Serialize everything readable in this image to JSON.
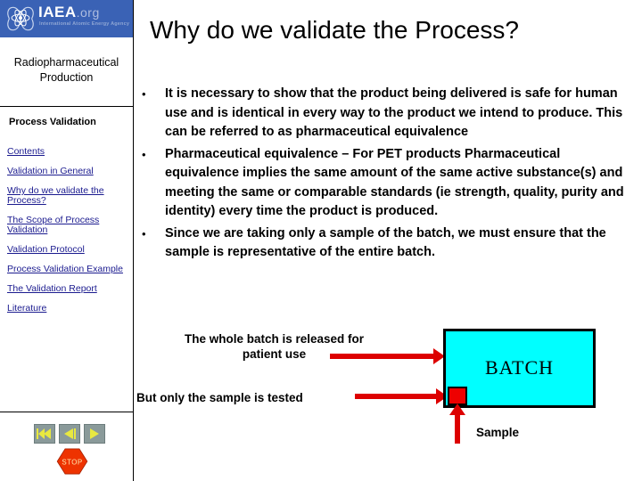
{
  "sidebar": {
    "logo": {
      "wordmark": "IAEA",
      "domain": ".org",
      "subtitle": "International Atomic Energy Agency",
      "banner_color": "#3a62b5"
    },
    "course_title": "Radiopharmaceutical Production",
    "section_label": "Process Validation",
    "links": [
      {
        "label": "Contents"
      },
      {
        "label": "Validation in General"
      },
      {
        "label": "Why do we validate the Process?"
      },
      {
        "label": "The Scope of Process Validation"
      },
      {
        "label": "Validation Protocol"
      },
      {
        "label": "Process Validation Example"
      },
      {
        "label": "The Validation Report"
      },
      {
        "label": "Literature"
      }
    ],
    "link_color": "#1b1b8f",
    "nav_buttons": [
      {
        "name": "first-slide-button",
        "glyph": "⏮"
      },
      {
        "name": "previous-slide-button",
        "glyph": "◀"
      },
      {
        "name": "next-slide-button",
        "glyph": "▶"
      }
    ],
    "stop_button_label": "STOP",
    "stop_button_color": "#ee3300"
  },
  "main": {
    "title": "Why do we validate the Process?",
    "bullet_marker": "•",
    "bullets": [
      "It is necessary to show that the product being delivered is safe for human use and is identical in every way to the product we intend to produce.  This can be referred to as pharmaceutical equivalence",
      "Pharmaceutical equivalence – For PET products Pharmaceutical equivalence implies the same amount of the same active substance(s) and meeting the same or comparable standards (ie strength, quality, purity and identity) every time the product is produced.",
      "Since we are taking only a sample of the batch, we must ensure that the sample is representative of the entire batch."
    ]
  },
  "diagram": {
    "batch_box_label": "BATCH",
    "batch_box_color": "#00ffff",
    "sample_square_color": "#ee0000",
    "arrow_color": "#dd0000",
    "caption_release": "The whole batch is released for patient use",
    "caption_sample_tested": "But only the sample is tested",
    "caption_sample": "Sample"
  }
}
